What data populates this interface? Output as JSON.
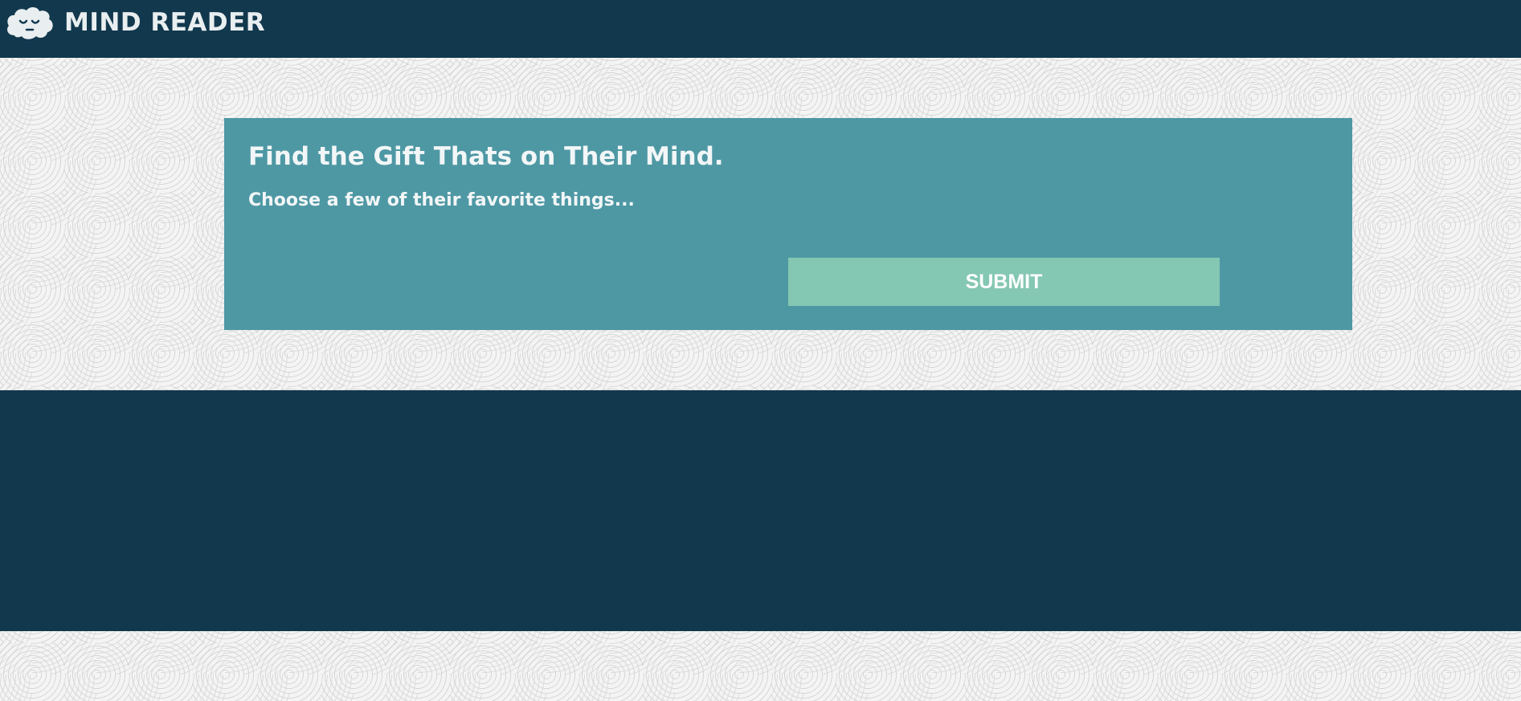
{
  "header": {
    "brand_name": "MIND READER",
    "logo_icon": "sleeping-cloud-face-icon",
    "background_color": "#11384d"
  },
  "main": {
    "title": "Find the Gift Thats on Their Mind.",
    "subtitle": "Choose a few of their favorite things...",
    "submit_label": "SUBMIT",
    "card_color": "#4e98a4",
    "button_color": "#84c7b2"
  }
}
